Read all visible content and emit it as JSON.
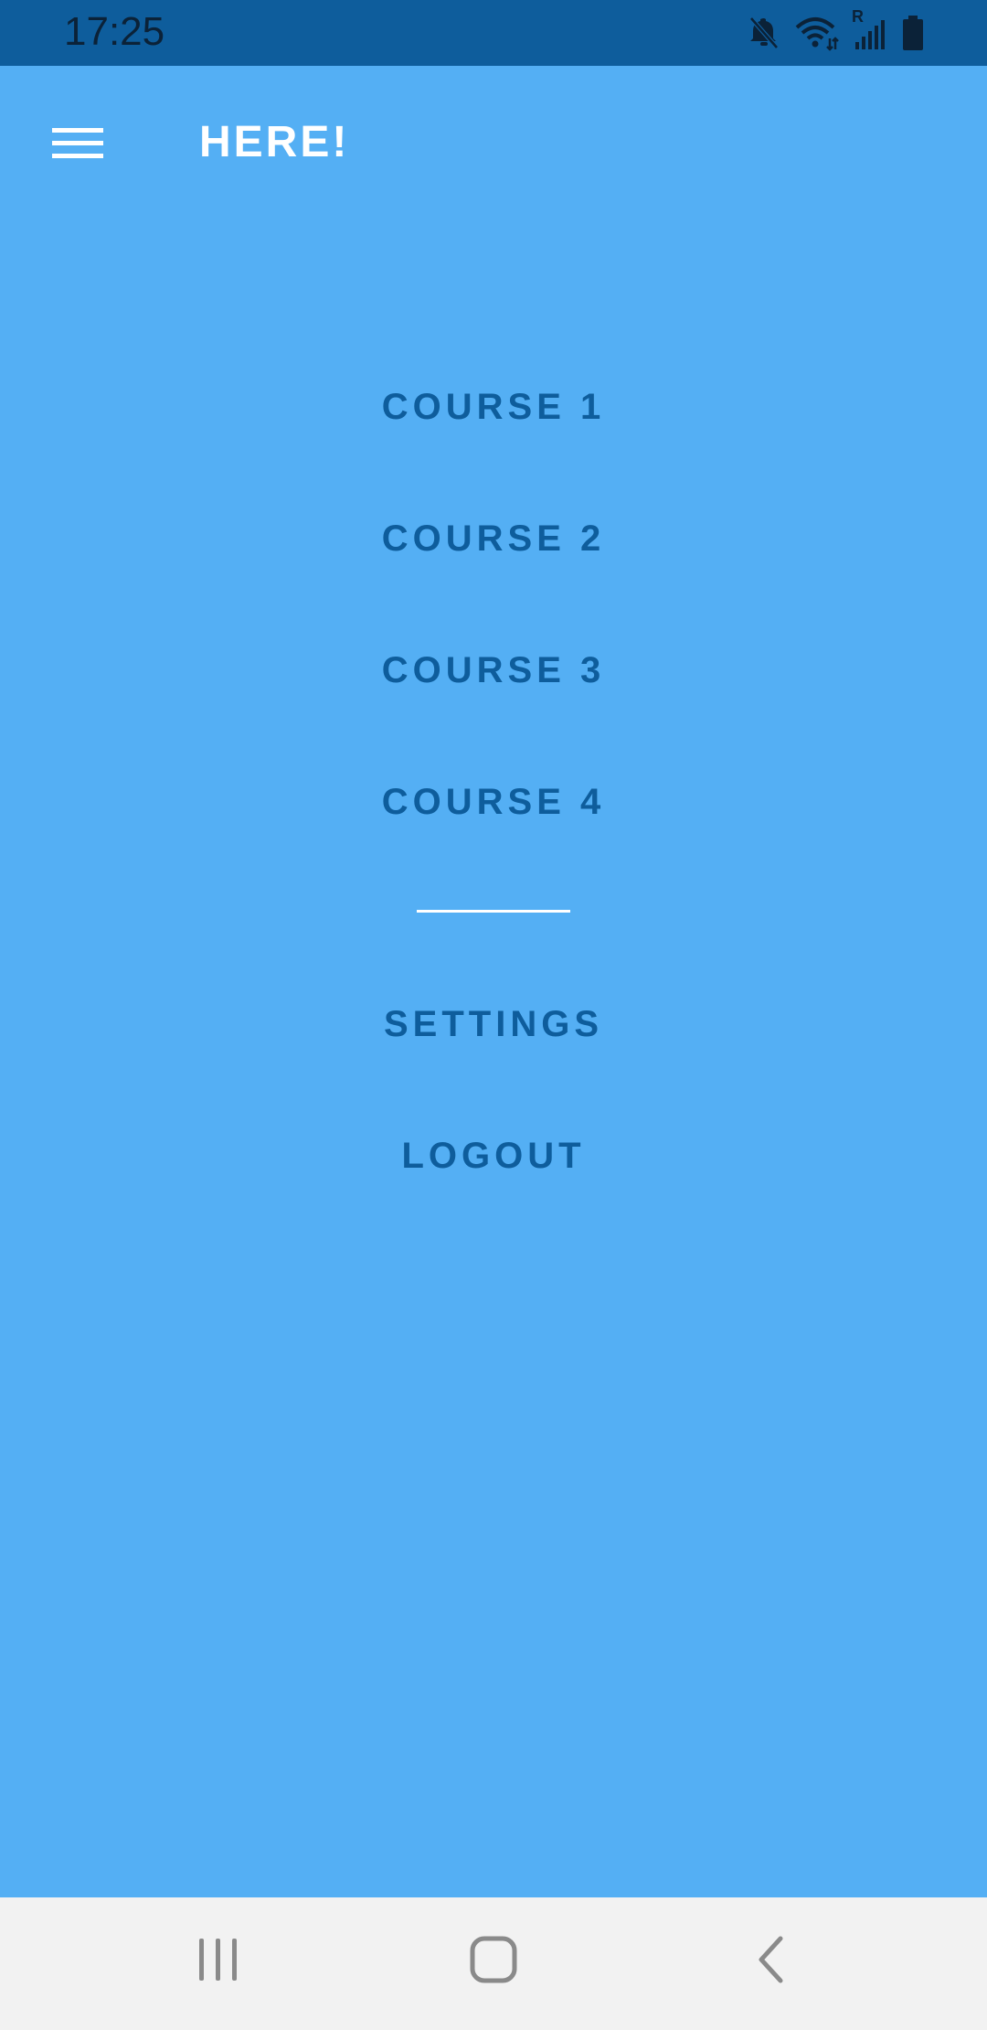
{
  "status_bar": {
    "time": "17:25",
    "icons": [
      "mute-icon",
      "wifi-icon",
      "signal-icon",
      "battery-icon"
    ],
    "roaming_label": "R"
  },
  "app_bar": {
    "title": "HERE!",
    "menu_icon": "hamburger-menu-icon"
  },
  "menu": {
    "courses": [
      "COURSE 1",
      "COURSE 2",
      "COURSE 3",
      "COURSE 4"
    ],
    "settings": "SETTINGS",
    "logout": "LOGOUT"
  },
  "nav_bar": {
    "icons": [
      "recent-apps-icon",
      "home-icon",
      "back-icon"
    ]
  },
  "colors": {
    "background": "#54AFF4",
    "status_bar": "#0E5D9C",
    "menu_text": "#0E5D9C",
    "title_text": "#FFFFFF",
    "nav_bar": "#F2F2F2"
  }
}
